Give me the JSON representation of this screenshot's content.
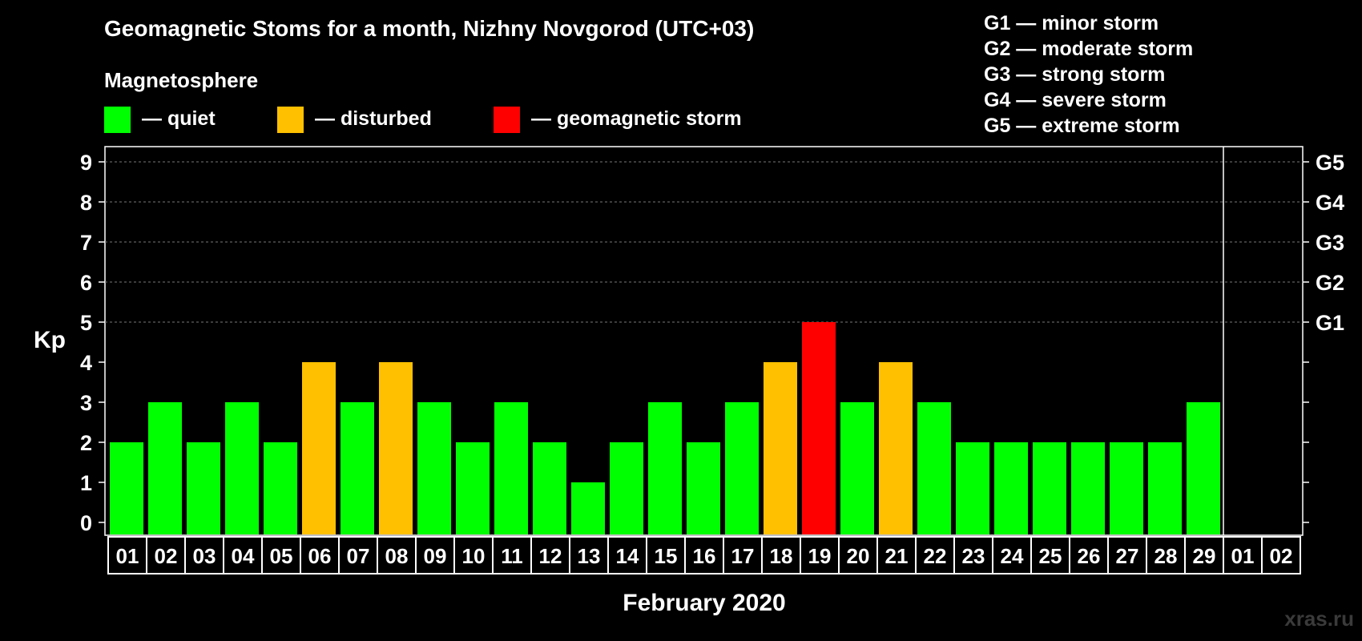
{
  "title": "Geomagnetic Stoms for a month, Nizhny Novgorod (UTC+03)",
  "legend": {
    "heading": "Magnetosphere",
    "items": [
      {
        "label": "— quiet",
        "color": "#00ff00"
      },
      {
        "label": "— disturbed",
        "color": "#ffc000"
      },
      {
        "label": "— geomagnetic storm",
        "color": "#ff0000"
      }
    ]
  },
  "g_scale": [
    "G1 — minor storm",
    "G2 — moderate storm",
    "G3 — strong storm",
    "G4 — severe storm",
    "G5 — extreme storm"
  ],
  "watermark": "xras.ru",
  "colors": {
    "quiet": "#00ff00",
    "disturbed": "#ffc000",
    "storm": "#ff0000",
    "background": "#000000",
    "axis": "#ffffff"
  },
  "chart_data": {
    "type": "bar",
    "title": "Geomagnetic Stoms for a month, Nizhny Novgorod (UTC+03)",
    "xlabel": "February 2020",
    "ylabel": "Kp",
    "ylim": [
      0,
      9
    ],
    "yticks": [
      "0",
      "1",
      "2",
      "3",
      "4",
      "5",
      "6",
      "7",
      "8",
      "9"
    ],
    "right_ticks": [
      {
        "value": 5,
        "label": "G1"
      },
      {
        "value": 6,
        "label": "G2"
      },
      {
        "value": 7,
        "label": "G3"
      },
      {
        "value": 8,
        "label": "G4"
      },
      {
        "value": 9,
        "label": "G5"
      }
    ],
    "grid": "dashed horizontal at 5-9",
    "categories": [
      "01",
      "02",
      "03",
      "04",
      "05",
      "06",
      "07",
      "08",
      "09",
      "10",
      "11",
      "12",
      "13",
      "14",
      "15",
      "16",
      "17",
      "18",
      "19",
      "20",
      "21",
      "22",
      "23",
      "24",
      "25",
      "26",
      "27",
      "28",
      "29",
      "01",
      "02"
    ],
    "values": [
      2,
      3,
      2,
      3,
      2,
      4,
      3,
      4,
      3,
      2,
      3,
      2,
      1,
      2,
      3,
      2,
      3,
      4,
      5,
      3,
      4,
      3,
      2,
      2,
      2,
      2,
      2,
      2,
      3,
      null,
      null
    ],
    "levels": [
      "quiet",
      "quiet",
      "quiet",
      "quiet",
      "quiet",
      "disturbed",
      "quiet",
      "disturbed",
      "quiet",
      "quiet",
      "quiet",
      "quiet",
      "quiet",
      "quiet",
      "quiet",
      "quiet",
      "quiet",
      "disturbed",
      "storm",
      "quiet",
      "disturbed",
      "quiet",
      "quiet",
      "quiet",
      "quiet",
      "quiet",
      "quiet",
      "quiet",
      "quiet",
      null,
      null
    ]
  }
}
